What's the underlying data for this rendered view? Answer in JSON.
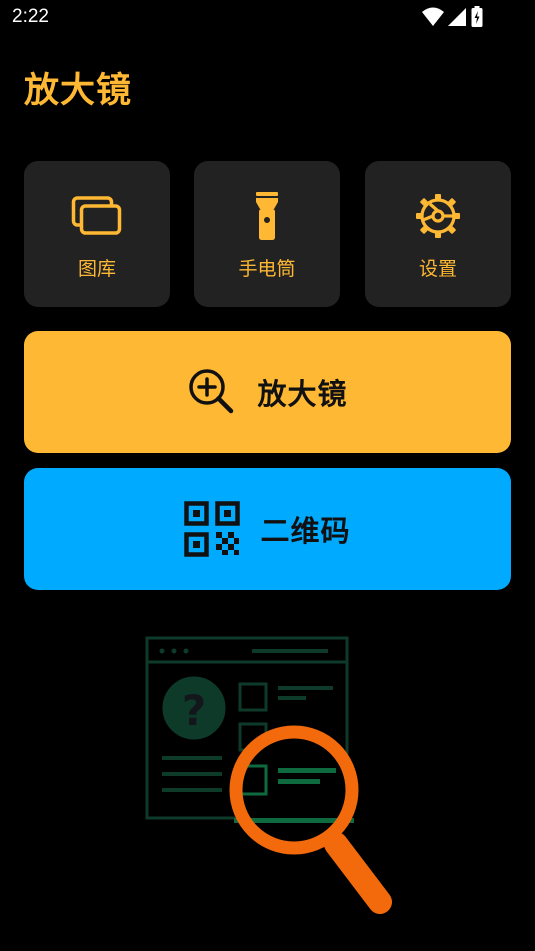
{
  "status_bar": {
    "time": "2:22"
  },
  "app_title": "放大镜",
  "tiles": [
    {
      "label": "图库",
      "icon": "gallery-icon"
    },
    {
      "label": "手电筒",
      "icon": "flashlight-icon"
    },
    {
      "label": "设置",
      "icon": "gear-icon"
    }
  ],
  "buttons": {
    "magnifier": {
      "label": "放大镜",
      "icon": "zoom-in-icon",
      "color": "#FFB833"
    },
    "qrcode": {
      "label": "二维码",
      "icon": "qr-code-icon",
      "color": "#00AAFF"
    }
  },
  "colors": {
    "accent": "#FFB833",
    "tile_bg": "#222222",
    "background": "#000000",
    "illustration_orange": "#F26A0B",
    "illustration_green": "#0E3A2A"
  }
}
